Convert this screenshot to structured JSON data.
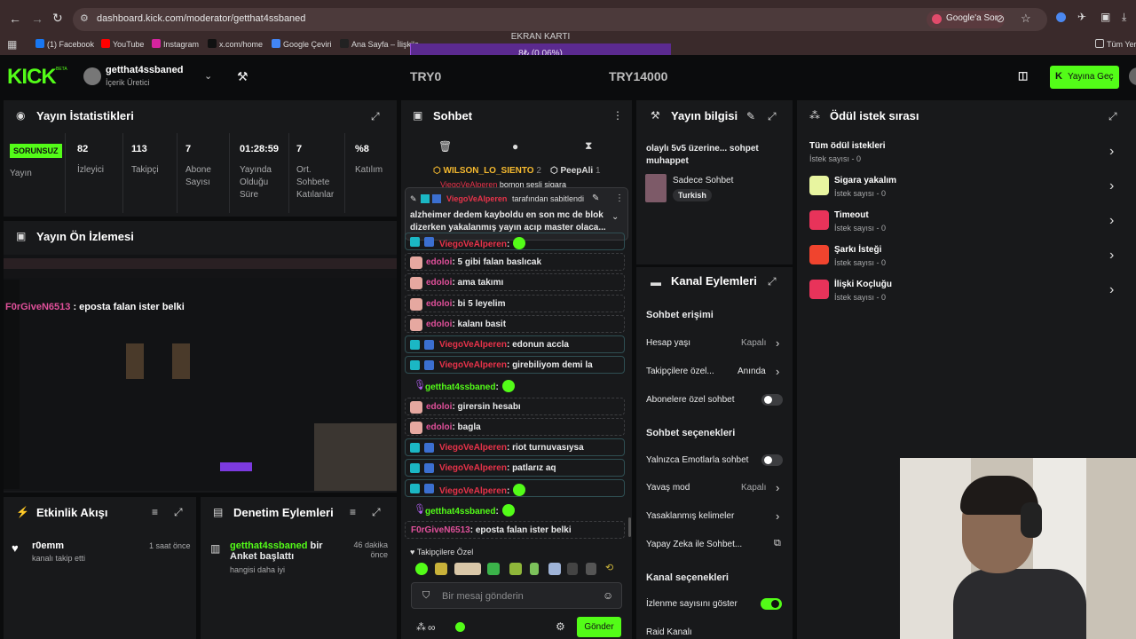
{
  "browser": {
    "url": "dashboard.kick.com/moderator/getthat4ssbaned",
    "google_sor": "Google'a Sor",
    "all_bookmarks": "Tüm Yer",
    "bookmarks": [
      "(1) Facebook",
      "YouTube",
      "Instagram",
      "x.com/home",
      "Google Çeviri",
      "Ana Sayfa – İlişkile..."
    ]
  },
  "overlay": {
    "title": "EKRAN KARTI",
    "progress_text": "8₺ (0.06%)",
    "progress_fraction": 0.0006,
    "left_amount": "TRY0",
    "right_amount": "TRY14000"
  },
  "header": {
    "logo": "KICK",
    "beta": "BETA",
    "username": "getthat4ssbaned",
    "role": "İçerik Üretici",
    "go_live": "Yayına Geç"
  },
  "stats": {
    "title": "Yayın İstatistikleri",
    "status_badge": "SORUNSUZ",
    "status_label": "Yayın",
    "items": [
      {
        "value": "82",
        "label": "İzleyici"
      },
      {
        "value": "113",
        "label": "Takipçi"
      },
      {
        "value": "7",
        "label": "Abone Sayısı"
      },
      {
        "value": "01:28:59",
        "label": "Yayında Olduğu Süre"
      },
      {
        "value": "7",
        "label": "Ort. Sohbete Katılanlar"
      },
      {
        "value": "%8",
        "label": "Katılım"
      }
    ]
  },
  "preview": {
    "title": "Yayın Ön İzlemesi",
    "overlay_msg_user": "F0rGiveN6513",
    "overlay_msg_text": " : eposta falan ister belki"
  },
  "activity": {
    "title": "Etkinlik Akışı",
    "items": [
      {
        "name": "r0emm",
        "desc": "kanalı takip etti",
        "time": "1 saat önce"
      }
    ]
  },
  "moderation": {
    "title": "Denetim Eylemleri",
    "items": [
      {
        "user": "getthat4ssbaned",
        "action": " bir Anket başlattı",
        "desc": "hangisi daha iyi",
        "time": "46 dakika önce"
      }
    ]
  },
  "chat": {
    "title": "Sohbet",
    "top_chatters": [
      {
        "name": "WILSON_LO_SIENTO",
        "count": "2"
      },
      {
        "name": "PeepAli",
        "count": "1"
      }
    ],
    "pinned": {
      "user": "ViegoVeAlperen",
      "by": "tarafından sabitlendi",
      "text": "alzheimer dedem kayboldu en son mc de blok dizerken yakalanmış yayın acıp master olaca...",
      "hidden_user": "ViegoVeAlperen",
      "hidden_text": "bomon sesli sigara"
    },
    "messages": [
      {
        "user": "ViegoVeAlperen",
        "text": ":",
        "kind": "mod"
      },
      {
        "user": "edoloi",
        "text": ": 5 gibi falan baslıcak",
        "kind": "av"
      },
      {
        "user": "edoloi",
        "text": ": ama takımı",
        "kind": "av"
      },
      {
        "user": "edoloi",
        "text": ": bi 5 leyelim",
        "kind": "av"
      },
      {
        "user": "edoloi",
        "text": ": kalanı basit",
        "kind": "av"
      },
      {
        "user": "ViegoVeAlperen",
        "text": ": edonun accla",
        "kind": "mod"
      },
      {
        "user": "ViegoVeAlperen",
        "text": ": girebiliyom demi la",
        "kind": "mod"
      },
      {
        "user": "getthat4ssbaned",
        "text": ":",
        "kind": "host"
      },
      {
        "user": "edoloi",
        "text": ": girersin hesabı",
        "kind": "av"
      },
      {
        "user": "edoloi",
        "text": ": bagla",
        "kind": "av"
      },
      {
        "user": "ViegoVeAlperen",
        "text": ": riot turnuvasıysa",
        "kind": "mod"
      },
      {
        "user": "ViegoVeAlperen",
        "text": ": patlarız aq",
        "kind": "mod"
      },
      {
        "user": "ViegoVeAlperen",
        "text": ":",
        "kind": "mod"
      },
      {
        "user": "getthat4ssbaned",
        "text": ":",
        "kind": "host"
      },
      {
        "user": "F0rGiveN6513",
        "text": ": eposta falan ister belki",
        "kind": "plain"
      }
    ],
    "emote_label": "Takipçilere Özel",
    "input_placeholder": "Bir mesaj gönderin",
    "send": "Gönder"
  },
  "stream_info": {
    "title": "Yayın bilgisi",
    "stream_title": "olaylı 5v5 üzerine... sohpet muhappet",
    "category": "Sadece Sohbet",
    "language": "Turkish"
  },
  "channel_actions": {
    "title": "Kanal Eylemleri",
    "chat_access": "Sohbet erişimi",
    "account_age": {
      "label": "Hesap yaşı",
      "value": "Kapalı"
    },
    "followers_only": {
      "label": "Takipçilere özel...",
      "value": "Anında"
    },
    "subs_only": "Abonelere özel sohbet",
    "chat_options": "Sohbet seçenekleri",
    "emotes_only": "Yalnızca Emotlarla sohbet",
    "slow_mode": {
      "label": "Yavaş mod",
      "value": "Kapalı"
    },
    "banned_words": "Yasaklanmış kelimeler",
    "ai_chat": "Yapay Zeka ile Sohbet...",
    "channel_options": "Kanal seçenekleri",
    "show_viewers": "İzlenme sayısını göster",
    "raid": "Raid Kanalı"
  },
  "rewards": {
    "title": "Ödül istek sırası",
    "items": [
      {
        "title": "Tüm ödül istekleri",
        "count": "İstek sayısı - 0",
        "color": ""
      },
      {
        "title": "Sigara yakalım",
        "count": "İstek sayısı - 0",
        "color": "#e8f5a0"
      },
      {
        "title": "Timeout",
        "count": "İstek sayısı - 0",
        "color": "#e8335a"
      },
      {
        "title": "Şarkı İsteği",
        "count": "İstek sayısı - 0",
        "color": "#f0442e"
      },
      {
        "title": "İlişki Koçluğu",
        "count": "İstek sayısı - 0",
        "color": "#e8335a"
      }
    ]
  }
}
